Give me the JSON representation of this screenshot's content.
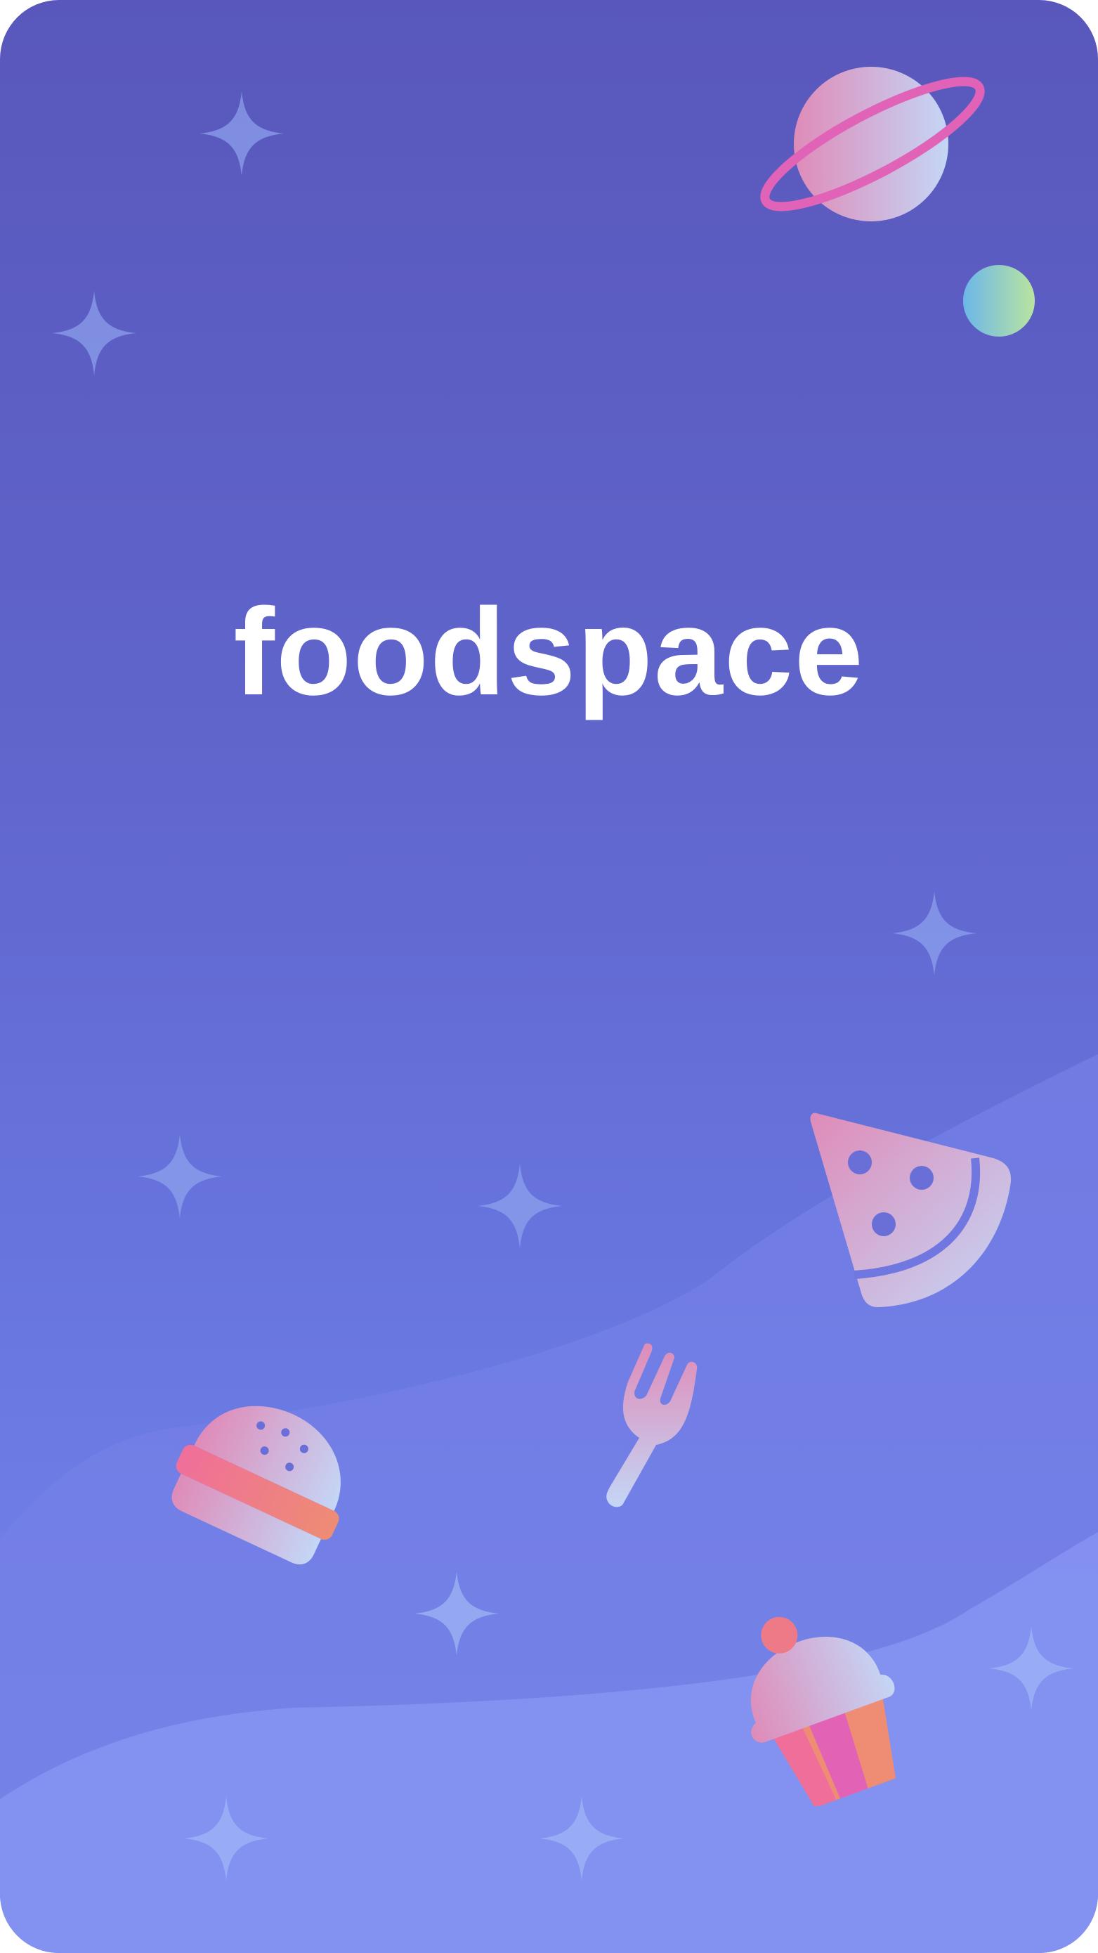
{
  "app": {
    "title": "foodspace"
  },
  "icons": {
    "planet": "ringed-planet-icon",
    "moon": "moon-icon",
    "sparkle": "sparkle-star-icon",
    "pizza": "pizza-slice-icon",
    "fork": "fork-icon",
    "burger": "burger-icon",
    "cupcake": "cupcake-icon"
  },
  "colors": {
    "background_top": "#5957bb",
    "background_bottom": "#8391f2",
    "title": "#ffffff",
    "accent_pink": "#e262b6",
    "accent_coral": "#ee8c74",
    "accent_lavender": "#c4d4f6"
  }
}
